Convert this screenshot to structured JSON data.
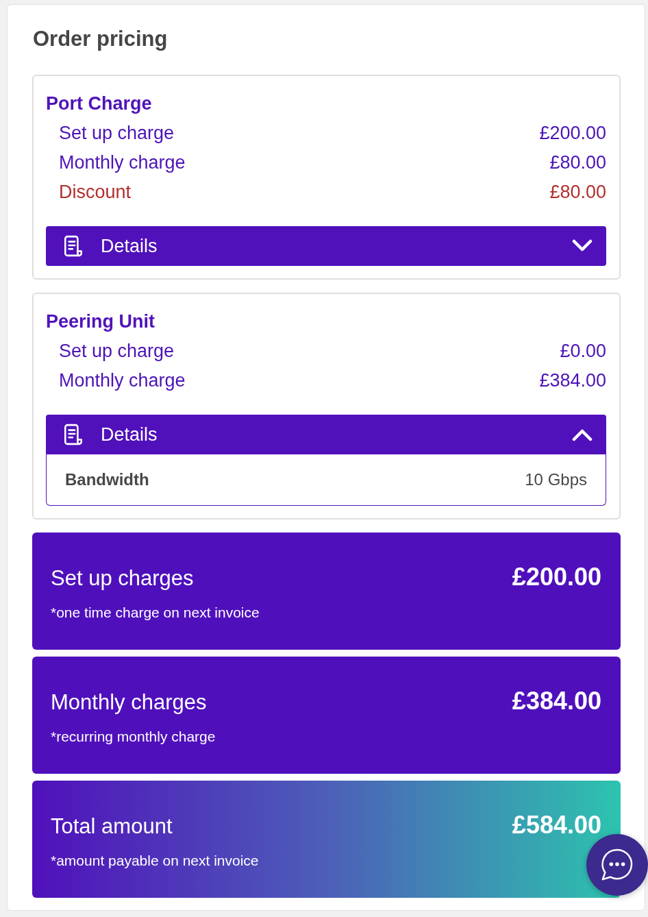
{
  "title": "Order pricing",
  "products": [
    {
      "name": "Port Charge",
      "charges": [
        {
          "label": "Set up charge",
          "amount": "£200.00",
          "kind": "charge"
        },
        {
          "label": "Monthly charge",
          "amount": "£80.00",
          "kind": "charge"
        },
        {
          "label": "Discount",
          "amount": "£80.00",
          "kind": "discount"
        }
      ],
      "details": {
        "label": "Details",
        "expanded": false
      }
    },
    {
      "name": "Peering Unit",
      "charges": [
        {
          "label": "Set up charge",
          "amount": "£0.00",
          "kind": "charge"
        },
        {
          "label": "Monthly charge",
          "amount": "£384.00",
          "kind": "charge"
        }
      ],
      "details": {
        "label": "Details",
        "expanded": true,
        "rows": [
          {
            "label": "Bandwidth",
            "value": "10 Gbps"
          }
        ]
      }
    }
  ],
  "summary": [
    {
      "title": "Set up charges",
      "amount": "£200.00",
      "note": "*one time charge on next invoice",
      "kind": "solid"
    },
    {
      "title": "Monthly charges",
      "amount": "£384.00",
      "note": "*recurring monthly charge",
      "kind": "solid"
    },
    {
      "title": "Total amount",
      "amount": "£584.00",
      "note": "*amount payable on next invoice",
      "kind": "gradient"
    }
  ]
}
